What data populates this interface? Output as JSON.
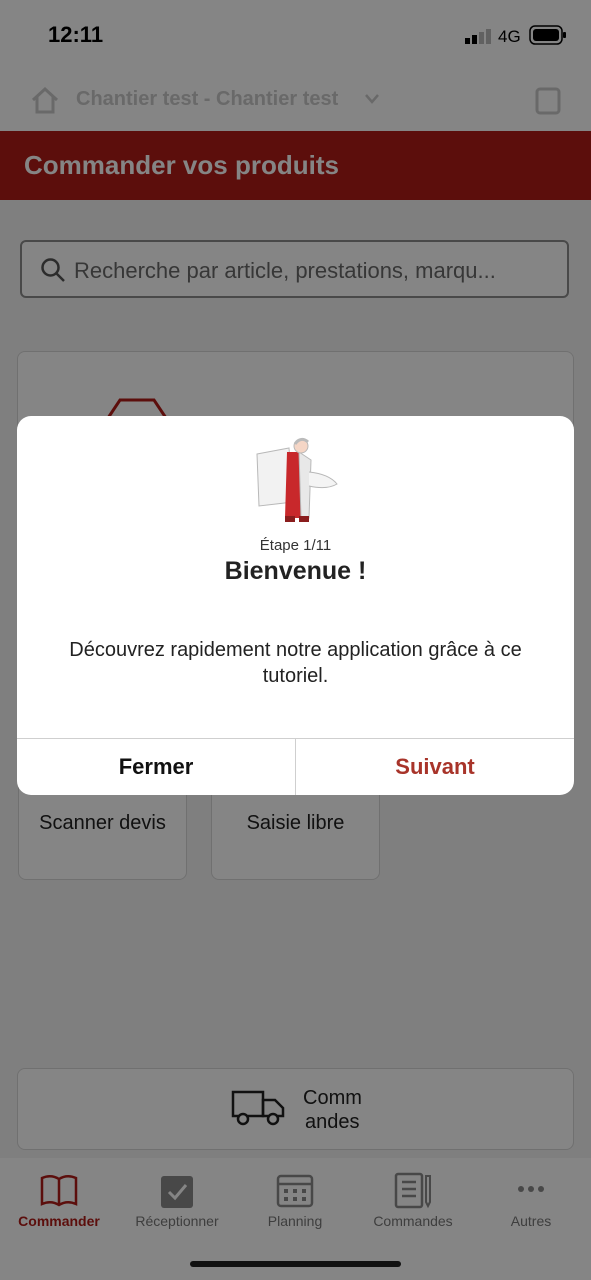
{
  "status_bar": {
    "time": "12:11",
    "network": "4G"
  },
  "header": {
    "site_selector": "Chantier test - Chantier test"
  },
  "page": {
    "title": "Commander vos produits"
  },
  "search": {
    "placeholder": "Recherche par article, prestations, marqu..."
  },
  "tiles": {
    "scan_quote": "Scanner devis",
    "free_entry": "Saisie libre"
  },
  "orders_card": {
    "label_line1": "Comm",
    "label_line2": "andes"
  },
  "tabs": [
    {
      "label": "Commander",
      "icon": "book-icon",
      "active": true
    },
    {
      "label": "Réceptionner",
      "icon": "clipboard-check-icon",
      "active": false
    },
    {
      "label": "Planning",
      "icon": "calendar-icon",
      "active": false
    },
    {
      "label": "Commandes",
      "icon": "list-icon",
      "active": false
    },
    {
      "label": "Autres",
      "icon": "more-icon",
      "active": false
    }
  ],
  "dialog": {
    "step": "Étape 1/11",
    "title": "Bienvenue !",
    "description": "Découvrez rapidement notre application grâce à ce tutoriel.",
    "close_label": "Fermer",
    "next_label": "Suivant"
  },
  "colors": {
    "accent": "#b01b17",
    "next_button": "#a8342a"
  }
}
